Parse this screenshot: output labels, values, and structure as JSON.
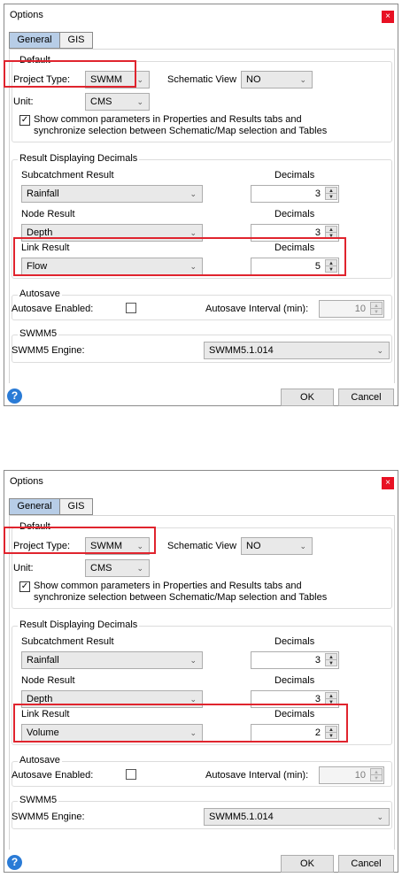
{
  "dialogs": [
    {
      "title": "Options",
      "close_glyph": "×",
      "tabs": [
        "General",
        "GIS"
      ],
      "active_tab": "General",
      "default_group": {
        "legend": "Default",
        "project_type_label": "Project Type:",
        "project_type_value": "SWMM",
        "schematic_view_label": "Schematic View",
        "schematic_view_value": "NO",
        "unit_label": "Unit:",
        "unit_value": "CMS",
        "sync_checkbox_checked": true,
        "sync_text_line1": "Show common parameters in Properties and Results tabs and",
        "sync_text_line2": "synchronize selection between Schematic/Map selection and Tables"
      },
      "decimals_group": {
        "legend": "Result Displaying Decimals",
        "subcatchment_label": "Subcatchment Result",
        "subcatchment_value": "Rainfall",
        "subcatchment_decimals": "3",
        "node_label": "Node Result",
        "node_value": "Depth",
        "node_decimals": "3",
        "link_label": "Link Result",
        "link_value": "Flow",
        "link_decimals": "5",
        "decimals_label": "Decimals"
      },
      "autosave_group": {
        "legend": "Autosave",
        "enabled_label": "Autosave Enabled:",
        "enabled_checked": false,
        "interval_label": "Autosave Interval (min):",
        "interval_value": "10"
      },
      "swmm5_group": {
        "legend": "SWMM5",
        "engine_label": "SWMM5 Engine:",
        "engine_value": "SWMM5.1.014"
      },
      "buttons": {
        "ok": "OK",
        "cancel": "Cancel",
        "help": "?"
      }
    },
    {
      "title": "Options",
      "close_glyph": "×",
      "tabs": [
        "General",
        "GIS"
      ],
      "active_tab": "General",
      "default_group": {
        "legend": "Default",
        "project_type_label": "Project Type:",
        "project_type_value": "SWMM",
        "schematic_view_label": "Schematic View",
        "schematic_view_value": "NO",
        "unit_label": "Unit:",
        "unit_value": "CMS",
        "sync_checkbox_checked": true,
        "sync_text_line1": "Show common parameters in Properties and Results tabs and",
        "sync_text_line2": "synchronize selection between Schematic/Map selection and Tables"
      },
      "decimals_group": {
        "legend": "Result Displaying Decimals",
        "subcatchment_label": "Subcatchment Result",
        "subcatchment_value": "Rainfall",
        "subcatchment_decimals": "3",
        "node_label": "Node Result",
        "node_value": "Depth",
        "node_decimals": "3",
        "link_label": "Link Result",
        "link_value": "Volume",
        "link_decimals": "2",
        "decimals_label": "Decimals"
      },
      "autosave_group": {
        "legend": "Autosave",
        "enabled_label": "Autosave Enabled:",
        "enabled_checked": false,
        "interval_label": "Autosave Interval (min):",
        "interval_value": "10"
      },
      "swmm5_group": {
        "legend": "SWMM5",
        "engine_label": "SWMM5 Engine:",
        "engine_value": "SWMM5.1.014"
      },
      "buttons": {
        "ok": "OK",
        "cancel": "Cancel",
        "help": "?"
      }
    }
  ],
  "colors": {
    "highlight": "#e0242e",
    "active_tab": "#b7cde7",
    "close_button": "#e81123",
    "help_icon": "#2a7bd6"
  },
  "icons": {
    "dropdown": "chevron-down-icon",
    "spin_up": "spin-up-icon",
    "spin_down": "spin-down-icon",
    "help": "help-icon",
    "close": "close-icon",
    "check": "check-icon"
  }
}
